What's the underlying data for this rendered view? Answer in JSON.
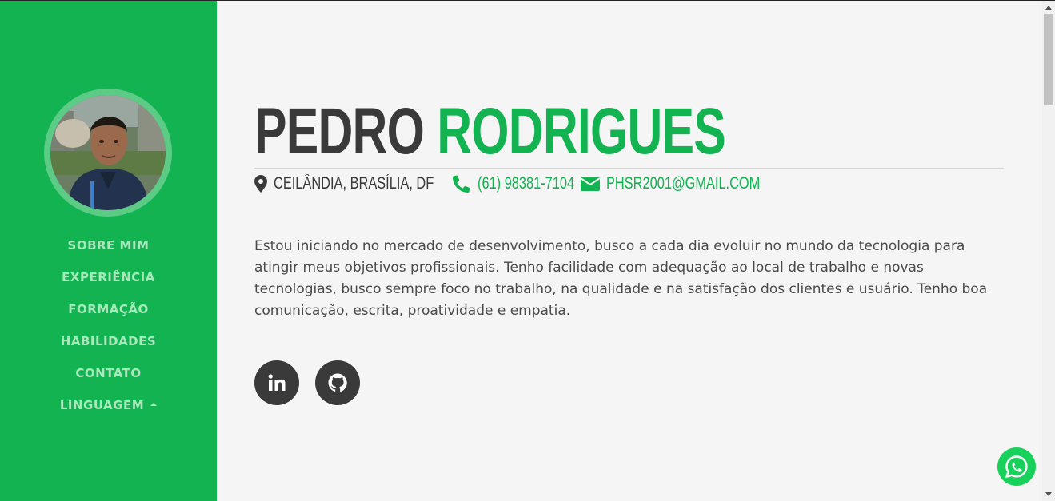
{
  "sidebar": {
    "nav": [
      {
        "label": "SOBRE MIM"
      },
      {
        "label": "EXPERIÊNCIA"
      },
      {
        "label": "FORMAÇÃO"
      },
      {
        "label": "HABILIDADES"
      },
      {
        "label": "CONTATO"
      },
      {
        "label": "LINGUAGEM"
      }
    ]
  },
  "header": {
    "first_name": "PEDRO",
    "last_name": "RODRIGUES"
  },
  "contact": {
    "location": "CEILÂNDIA, BRASÍLIA, DF",
    "location_icon": "map-marker-icon",
    "phone": "(61) 98381-7104",
    "phone_icon": "phone-icon",
    "email": "PHSR2001@GMAIL.COM",
    "email_icon": "envelope-icon"
  },
  "about": "Estou iniciando no mercado de desenvolvimento, busco a cada dia evoluir no mundo da tecnologia para atingir meus objetivos profissionais. Tenho facilidade com adequação ao local de trabalho e novas tecnologias, busco sempre foco no trabalho, na qualidade e na satisfação dos clientes e usuário. Tenho boa comunicação, escrita, proatividade e empatia.",
  "social": [
    {
      "icon": "linkedin-icon"
    },
    {
      "icon": "github-icon"
    }
  ],
  "floating": {
    "icon": "whatsapp-icon"
  },
  "colors": {
    "accent": "#13b351",
    "text_dark": "#3a3a3a",
    "background": "#f5f5f5",
    "nav_text": "#a8e8bd",
    "whatsapp": "#18d15a"
  }
}
